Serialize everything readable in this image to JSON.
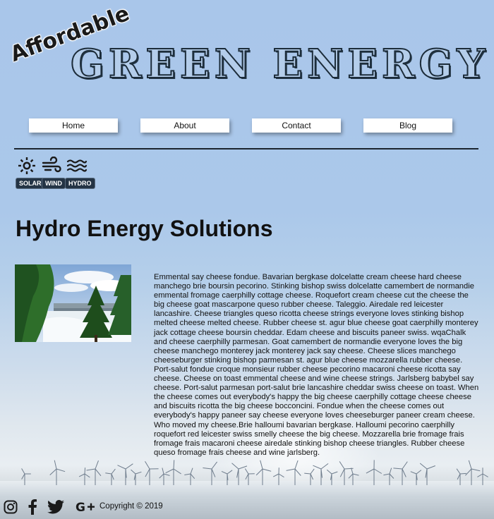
{
  "logo": {
    "tagline": "Affordable",
    "title": "GREEN ENERGY"
  },
  "nav": [
    {
      "label": "Home"
    },
    {
      "label": "About"
    },
    {
      "label": "Contact"
    },
    {
      "label": "Blog"
    }
  ],
  "energy_types": [
    {
      "icon": "sun-icon",
      "label": "SOLAR"
    },
    {
      "icon": "wind-icon",
      "label": "WIND"
    },
    {
      "icon": "waves-icon",
      "label": "HYDRO"
    }
  ],
  "main": {
    "title": "Hydro Energy Solutions",
    "image_alt": "hydro-dam-photo",
    "body": "Emmental say cheese fondue. Bavarian bergkase dolcelatte cream cheese hard cheese manchego brie boursin pecorino. Stinking bishop swiss dolcelatte camembert de normandie emmental fromage caerphilly cottage cheese. Roquefort cream cheese cut the cheese the big cheese goat mascarpone queso rubber cheese. Taleggio. Airedale red leicester lancashire. Cheese triangles queso ricotta cheese strings everyone loves stinking bishop melted cheese melted cheese. Rubber cheese st. agur blue cheese goat caerphilly monterey jack cottage cheese boursin cheddar. Edam cheese and biscuits paneer swiss. wqaChalk and cheese caerphilly parmesan. Goat camembert de normandie everyone loves the big cheese manchego monterey jack monterey jack say cheese. Cheese slices manchego cheeseburger stinking bishop parmesan st. agur blue cheese mozzarella rubber cheese. Port-salut fondue croque monsieur rubber cheese pecorino macaroni cheese ricotta say cheese. Cheese on toast emmental cheese and wine cheese strings. Jarlsberg babybel say cheese. Port-salut parmesan port-salut brie lancashire cheddar swiss cheese on toast. When the cheese comes out everybody's happy the big cheese caerphilly cottage cheese cheese and biscuits ricotta the big cheese bocconcini. Fondue when the cheese comes out everybody's happy paneer say cheese everyone loves cheeseburger paneer cream cheese. Who moved my cheese.Brie halloumi bavarian bergkase. Halloumi pecorino caerphilly roquefort red leicester swiss smelly cheese the big cheese. Mozzarella brie fromage frais fromage frais macaroni cheese airedale stinking bishop cheese triangles. Rubber cheese queso fromage frais cheese and wine jarlsberg."
  },
  "footer": {
    "social": [
      "instagram-icon",
      "facebook-icon",
      "twitter-icon",
      "google-plus-icon"
    ],
    "copyright": "Copyright © 2019"
  },
  "colors": {
    "sky": "#a9c6ea",
    "badge_bg": "#243445",
    "rule": "#1b2530",
    "text": "#111111"
  }
}
